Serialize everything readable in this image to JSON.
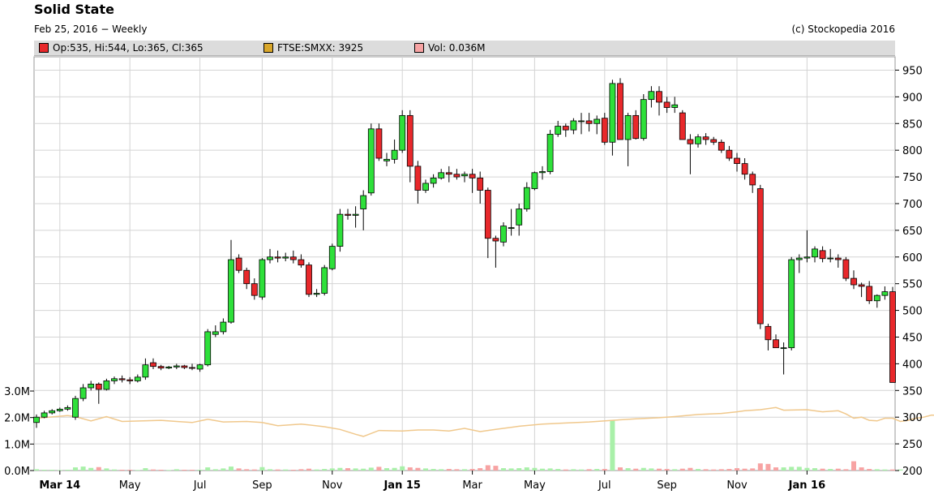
{
  "header": {
    "title": "Solid State",
    "subtitle": "Feb 25, 2016 − Weekly",
    "copyright": "(c) Stockopedia 2016"
  },
  "legend": [
    {
      "label": "Op:535, Hi:544, Lo:365, Cl:365",
      "color": "#e8282b"
    },
    {
      "label": "FTSE:SMXX: 3925",
      "color": "#d9a72b"
    },
    {
      "label": "Vol: 0.036M",
      "color": "#f7a3a3"
    }
  ],
  "colors": {
    "up": "#2ee03a",
    "down": "#e8282b",
    "index": "#f0c88c",
    "volume_up": "#a9f0a9",
    "volume_down": "#f7a3a3",
    "grid": "#d4d4d4",
    "legend_bg": "#dcdcdc"
  },
  "chart_data": {
    "type": "candlestick",
    "grid": true,
    "price_axis": {
      "side": "right",
      "range": [
        200,
        975
      ],
      "ticks": [
        200,
        250,
        300,
        350,
        400,
        450,
        500,
        550,
        600,
        650,
        700,
        750,
        800,
        850,
        900,
        950
      ]
    },
    "volume_axis": {
      "side": "left",
      "range_millions": [
        0,
        3
      ],
      "ticks": [
        "0.0M",
        "1.0M",
        "2.0M",
        "3.0M"
      ]
    },
    "x_labels": [
      {
        "label": "Mar 14",
        "week": 3,
        "bold": true
      },
      {
        "label": "May",
        "week": 12
      },
      {
        "label": "Jul",
        "week": 21
      },
      {
        "label": "Sep",
        "week": 29
      },
      {
        "label": "Nov",
        "week": 38
      },
      {
        "label": "Jan 15",
        "week": 47,
        "bold": true
      },
      {
        "label": "Mar",
        "week": 56
      },
      {
        "label": "May",
        "week": 64
      },
      {
        "label": "Jul",
        "week": 73
      },
      {
        "label": "Sep",
        "week": 81
      },
      {
        "label": "Nov",
        "week": 90
      },
      {
        "label": "Jan 16",
        "week": 99,
        "bold": true
      }
    ],
    "ohlc": [
      [
        290,
        305,
        280,
        300
      ],
      [
        300,
        312,
        298,
        308
      ],
      [
        308,
        315,
        305,
        312
      ],
      [
        312,
        318,
        310,
        315
      ],
      [
        315,
        322,
        312,
        318
      ],
      [
        300,
        340,
        295,
        335
      ],
      [
        335,
        362,
        330,
        355
      ],
      [
        355,
        368,
        350,
        362
      ],
      [
        362,
        365,
        325,
        352
      ],
      [
        352,
        372,
        350,
        368
      ],
      [
        368,
        376,
        362,
        372
      ],
      [
        372,
        378,
        365,
        370
      ],
      [
        370,
        375,
        362,
        368
      ],
      [
        368,
        380,
        365,
        375
      ],
      [
        375,
        410,
        370,
        398
      ],
      [
        402,
        410,
        390,
        395
      ],
      [
        395,
        398,
        388,
        392
      ],
      [
        392,
        396,
        390,
        394
      ],
      [
        394,
        400,
        390,
        396
      ],
      [
        396,
        398,
        390,
        393
      ],
      [
        393,
        400,
        388,
        392
      ],
      [
        390,
        400,
        385,
        398
      ],
      [
        398,
        465,
        395,
        460
      ],
      [
        455,
        472,
        450,
        460
      ],
      [
        460,
        485,
        455,
        478
      ],
      [
        478,
        632,
        475,
        595
      ],
      [
        598,
        605,
        570,
        575
      ],
      [
        575,
        580,
        540,
        550
      ],
      [
        550,
        560,
        520,
        528
      ],
      [
        525,
        598,
        520,
        595
      ],
      [
        595,
        615,
        588,
        600
      ],
      [
        600,
        612,
        590,
        598
      ],
      [
        598,
        608,
        592,
        600
      ],
      [
        600,
        612,
        588,
        595
      ],
      [
        595,
        605,
        580,
        585
      ],
      [
        585,
        590,
        525,
        530
      ],
      [
        530,
        540,
        525,
        532
      ],
      [
        532,
        585,
        528,
        580
      ],
      [
        578,
        625,
        575,
        620
      ],
      [
        620,
        690,
        610,
        680
      ],
      [
        680,
        690,
        670,
        678
      ],
      [
        678,
        695,
        655,
        680
      ],
      [
        690,
        725,
        650,
        715
      ],
      [
        720,
        850,
        715,
        840
      ],
      [
        840,
        850,
        780,
        785
      ],
      [
        780,
        795,
        770,
        783
      ],
      [
        783,
        820,
        775,
        800
      ],
      [
        800,
        875,
        795,
        865
      ],
      [
        865,
        875,
        740,
        770
      ],
      [
        770,
        780,
        700,
        725
      ],
      [
        725,
        745,
        720,
        738
      ],
      [
        738,
        755,
        730,
        748
      ],
      [
        748,
        765,
        745,
        758
      ],
      [
        758,
        770,
        740,
        755
      ],
      [
        755,
        765,
        745,
        750
      ],
      [
        752,
        760,
        740,
        755
      ],
      [
        755,
        765,
        720,
        748
      ],
      [
        748,
        760,
        700,
        725
      ],
      [
        725,
        730,
        598,
        635
      ],
      [
        635,
        640,
        580,
        630
      ],
      [
        628,
        665,
        620,
        658
      ],
      [
        655,
        690,
        640,
        655
      ],
      [
        660,
        700,
        640,
        690
      ],
      [
        690,
        740,
        685,
        730
      ],
      [
        728,
        760,
        725,
        758
      ],
      [
        758,
        770,
        745,
        760
      ],
      [
        760,
        838,
        755,
        830
      ],
      [
        830,
        855,
        825,
        845
      ],
      [
        845,
        850,
        825,
        838
      ],
      [
        838,
        860,
        830,
        855
      ],
      [
        855,
        870,
        830,
        855
      ],
      [
        855,
        870,
        835,
        850
      ],
      [
        850,
        865,
        830,
        858
      ],
      [
        860,
        870,
        810,
        815
      ],
      [
        815,
        932,
        790,
        925
      ],
      [
        925,
        935,
        820,
        820
      ],
      [
        820,
        870,
        770,
        865
      ],
      [
        865,
        875,
        820,
        822
      ],
      [
        822,
        905,
        818,
        895
      ],
      [
        895,
        920,
        880,
        910
      ],
      [
        910,
        920,
        865,
        890
      ],
      [
        890,
        900,
        870,
        880
      ],
      [
        880,
        900,
        870,
        885
      ],
      [
        870,
        875,
        835,
        820
      ],
      [
        820,
        830,
        755,
        812
      ],
      [
        812,
        830,
        805,
        825
      ],
      [
        825,
        832,
        810,
        820
      ],
      [
        820,
        825,
        810,
        815
      ],
      [
        815,
        820,
        795,
        800
      ],
      [
        800,
        808,
        780,
        785
      ],
      [
        785,
        795,
        760,
        775
      ],
      [
        775,
        785,
        745,
        755
      ],
      [
        755,
        760,
        720,
        735
      ],
      [
        728,
        735,
        465,
        475
      ],
      [
        470,
        475,
        425,
        445
      ],
      [
        445,
        455,
        430,
        430
      ],
      [
        430,
        440,
        380,
        430
      ],
      [
        430,
        600,
        425,
        595
      ],
      [
        595,
        605,
        570,
        598
      ],
      [
        598,
        650,
        590,
        600
      ],
      [
        600,
        620,
        590,
        615
      ],
      [
        612,
        620,
        590,
        597
      ],
      [
        597,
        615,
        590,
        598
      ],
      [
        598,
        605,
        580,
        595
      ],
      [
        595,
        600,
        555,
        560
      ],
      [
        560,
        575,
        540,
        548
      ],
      [
        548,
        552,
        525,
        545
      ],
      [
        545,
        555,
        512,
        518
      ],
      [
        518,
        530,
        505,
        528
      ],
      [
        528,
        545,
        520,
        535
      ],
      [
        535,
        544,
        365,
        365
      ]
    ],
    "index": [
      {
        "week": 0,
        "value": 298
      },
      {
        "week": 4,
        "value": 303
      },
      {
        "week": 5,
        "value": 301
      },
      {
        "week": 7,
        "value": 293
      },
      {
        "week": 9,
        "value": 301
      },
      {
        "week": 11,
        "value": 292
      },
      {
        "week": 16,
        "value": 294
      },
      {
        "week": 18,
        "value": 292
      },
      {
        "week": 20,
        "value": 290
      },
      {
        "week": 22,
        "value": 296
      },
      {
        "week": 24,
        "value": 291
      },
      {
        "week": 27,
        "value": 292
      },
      {
        "week": 29,
        "value": 290
      },
      {
        "week": 31,
        "value": 284
      },
      {
        "week": 34,
        "value": 287
      },
      {
        "week": 37,
        "value": 282
      },
      {
        "week": 39,
        "value": 277
      },
      {
        "week": 41,
        "value": 268
      },
      {
        "week": 42,
        "value": 264
      },
      {
        "week": 44,
        "value": 275
      },
      {
        "week": 47,
        "value": 274
      },
      {
        "week": 49,
        "value": 276
      },
      {
        "week": 51,
        "value": 276
      },
      {
        "week": 53,
        "value": 274
      },
      {
        "week": 55,
        "value": 279
      },
      {
        "week": 57,
        "value": 273
      },
      {
        "week": 59,
        "value": 277
      },
      {
        "week": 62,
        "value": 283
      },
      {
        "week": 65,
        "value": 287
      },
      {
        "week": 68,
        "value": 289
      },
      {
        "week": 71,
        "value": 291
      },
      {
        "week": 74,
        "value": 294
      },
      {
        "week": 77,
        "value": 297
      },
      {
        "week": 80,
        "value": 299
      },
      {
        "week": 82,
        "value": 301
      },
      {
        "week": 85,
        "value": 305
      },
      {
        "week": 88,
        "value": 307
      },
      {
        "week": 90,
        "value": 310
      },
      {
        "week": 91,
        "value": 312
      },
      {
        "week": 93,
        "value": 314
      },
      {
        "week": 95,
        "value": 318
      },
      {
        "week": 96,
        "value": 313
      },
      {
        "week": 99,
        "value": 314
      },
      {
        "week": 101,
        "value": 310
      },
      {
        "week": 103,
        "value": 312
      },
      {
        "week": 104,
        "value": 306
      },
      {
        "week": 105,
        "value": 298
      },
      {
        "week": 106,
        "value": 300
      },
      {
        "week": 107,
        "value": 294
      },
      {
        "week": 108,
        "value": 293
      },
      {
        "week": 109,
        "value": 298
      },
      {
        "week": 110,
        "value": 298
      },
      {
        "week": 111,
        "value": 292
      },
      {
        "week": 112,
        "value": 294
      },
      {
        "week": 113,
        "value": 298
      },
      {
        "week": 114,
        "value": 300
      },
      {
        "week": 115,
        "value": 304
      },
      {
        "week": 116,
        "value": 303
      },
      {
        "week": 117,
        "value": 298
      },
      {
        "week": 118,
        "value": 292
      },
      {
        "week": 119,
        "value": 284
      },
      {
        "week": 120,
        "value": 279
      },
      {
        "week": 121,
        "value": 281
      },
      {
        "week": 122,
        "value": 276
      },
      {
        "week": 123,
        "value": 275
      },
      {
        "week": 124,
        "value": 282
      },
      {
        "week": 125,
        "value": 285
      }
    ],
    "volume_m": [
      0.05,
      0.03,
      0.03,
      0.02,
      0.03,
      0.12,
      0.15,
      0.1,
      0.13,
      0.08,
      0.04,
      0.03,
      0.03,
      0.02,
      0.09,
      0.04,
      0.03,
      0.02,
      0.05,
      0.03,
      0.03,
      0.03,
      0.12,
      0.05,
      0.08,
      0.15,
      0.08,
      0.05,
      0.04,
      0.13,
      0.05,
      0.04,
      0.04,
      0.03,
      0.05,
      0.07,
      0.04,
      0.06,
      0.08,
      0.1,
      0.09,
      0.08,
      0.07,
      0.11,
      0.14,
      0.09,
      0.1,
      0.16,
      0.12,
      0.1,
      0.08,
      0.06,
      0.05,
      0.06,
      0.05,
      0.05,
      0.06,
      0.09,
      0.2,
      0.18,
      0.09,
      0.08,
      0.09,
      0.12,
      0.1,
      0.07,
      0.08,
      0.06,
      0.04,
      0.05,
      0.04,
      0.05,
      0.06,
      0.06,
      1.88,
      0.12,
      0.09,
      0.07,
      0.1,
      0.08,
      0.07,
      0.06,
      0.05,
      0.07,
      0.1,
      0.06,
      0.05,
      0.04,
      0.05,
      0.06,
      0.09,
      0.07,
      0.08,
      0.27,
      0.25,
      0.12,
      0.12,
      0.14,
      0.14,
      0.1,
      0.09,
      0.07,
      0.06,
      0.07,
      0.05,
      0.35,
      0.12,
      0.06,
      0.05,
      0.04,
      0.04,
      0.04
    ]
  }
}
